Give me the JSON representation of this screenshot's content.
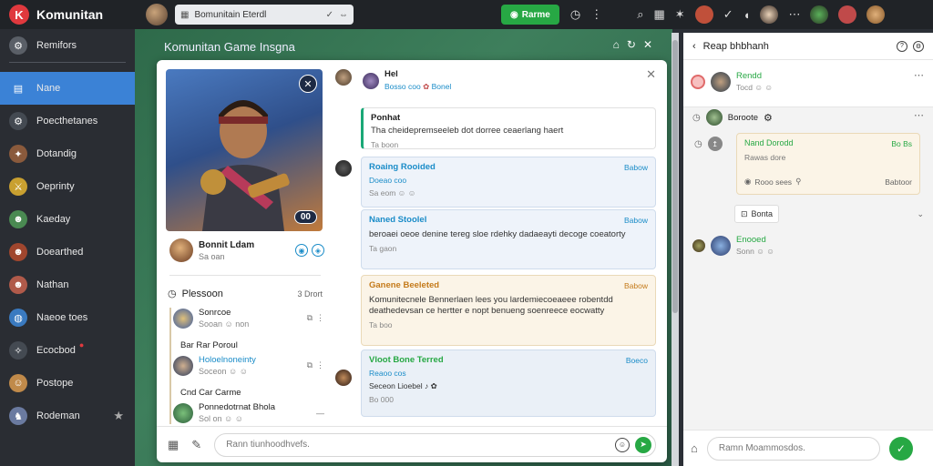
{
  "app": {
    "name": "Komunitan",
    "logo": "K"
  },
  "topbar": {
    "search_value": "Bomunitain Eterdl",
    "primary_button": "Rarme"
  },
  "sidebar": {
    "items": [
      {
        "label": "Remifors",
        "icon": "settings-icon",
        "color": "#5a5f67"
      },
      {
        "label": "Nane",
        "icon": "board-icon",
        "color": "#3b82d6",
        "active": true
      },
      {
        "label": "Poecthetanes",
        "icon": "gear-icon",
        "color": "#444a52"
      },
      {
        "label": "Dotandig",
        "icon": "game-icon",
        "color": "#8a5a3c"
      },
      {
        "label": "Oeprinty",
        "icon": "sword-icon",
        "color": "#c9a030"
      },
      {
        "label": "Kaeday",
        "icon": "hero-icon",
        "color": "#4a8a52"
      },
      {
        "label": "Doearthed",
        "icon": "warrior-icon",
        "color": "#a0462e"
      },
      {
        "label": "Nathan",
        "icon": "portrait-icon",
        "color": "#b05a4a"
      },
      {
        "label": "Naeoe toes",
        "icon": "planet-icon",
        "color": "#3a7ac0"
      },
      {
        "label": "Ecocbod",
        "icon": "mage-icon",
        "color": "#444a52",
        "badge": "●"
      },
      {
        "label": "Postope",
        "icon": "face-icon",
        "color": "#c08a4a"
      },
      {
        "label": "Rodeman",
        "icon": "knight-icon",
        "color": "#6a7aa0",
        "star": "★"
      }
    ]
  },
  "backdrop": {
    "title": "Komunitan Game Insgna"
  },
  "modal": {
    "hero_badge": "00",
    "profile": {
      "name": "Bonnit Ldam",
      "sub": "Sa oan"
    },
    "playlist": {
      "title": "Plessoon",
      "count": "3 Drort",
      "rows": [
        {
          "title": "Sonrcoe",
          "sub": "Sooan",
          "time": "non"
        },
        {
          "label": "Bar Rar Poroul"
        },
        {
          "title": "Holoelnoneinty",
          "sub": "Soceon",
          "highlight": true
        },
        {
          "label": "Cnd Car Carme"
        },
        {
          "title": "Ponnedotrnat Bhola",
          "sub": "Sol on"
        }
      ]
    },
    "chat": {
      "header": {
        "name": "Hel",
        "sub": "Bosso coo",
        "tag": "Bonel"
      },
      "messages": [
        {
          "title": "Ponhat",
          "body": "Tha cheidepremseeleb dot dorree ceaerlang haert",
          "meta": "Ta boon",
          "style": "plain"
        },
        {
          "title": "Roaing Rooided",
          "right": "Babow",
          "sub": "Doeao coo",
          "meta": "Sa eom",
          "style": "blue"
        },
        {
          "title": "Naned Stoolel",
          "right": "Babow",
          "body": "beroaei oeoe denine tereg sloe rdehky dadaeayti decoge coeatorty",
          "meta": "Ta gaon",
          "style": "blue"
        },
        {
          "title": "Ganene Beeleted",
          "right": "Babow",
          "body": "Komunitecnele Bennerlaen lees you lardemiecoeaeee robentdd deathedevsan ce hertter e nopt benueng soenreece eocwatty",
          "meta": "Ta boo",
          "style": "beige"
        },
        {
          "title": "Vloot Bone Terred",
          "right": "Boeco",
          "sub": "Reaoo cos",
          "meta2": "Seceon Lioebel",
          "meta": "Bo 000",
          "style": "blue2"
        }
      ]
    },
    "input_placeholder": "Rann tiunhoodhvefs."
  },
  "right_panel": {
    "title": "Reap bhbhanh",
    "top_user": {
      "name": "Rendd",
      "sub": "Tocd"
    },
    "row1": {
      "name": "Boroote"
    },
    "card": {
      "title": "Nand Dorodd",
      "right": "Bo Bs",
      "sub": "Rawas dore",
      "meta": "Rooo sees",
      "meta_right": "Babtoor"
    },
    "chip": "Bonta",
    "row2": {
      "name": "Enooed",
      "sub": "Sonn"
    },
    "input_placeholder": "Ramn Moammosdos."
  }
}
